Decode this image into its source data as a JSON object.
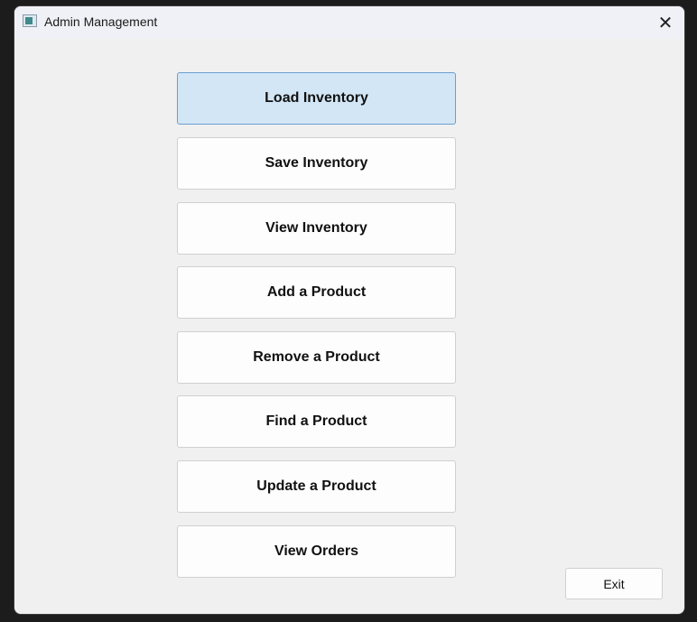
{
  "window": {
    "title": "Admin Management",
    "close_icon": "close-icon"
  },
  "menu": [
    {
      "label": "Load Inventory",
      "state": "hover"
    },
    {
      "label": "Save Inventory"
    },
    {
      "label": "View Inventory"
    },
    {
      "label": "Add a Product"
    },
    {
      "label": "Remove a Product"
    },
    {
      "label": "Find a Product"
    },
    {
      "label": "Update a Product"
    },
    {
      "label": "View Orders"
    }
  ],
  "exit_label": "Exit",
  "colors": {
    "hover_bg": "#d3e6f6",
    "hover_border": "#6b9fd0"
  }
}
